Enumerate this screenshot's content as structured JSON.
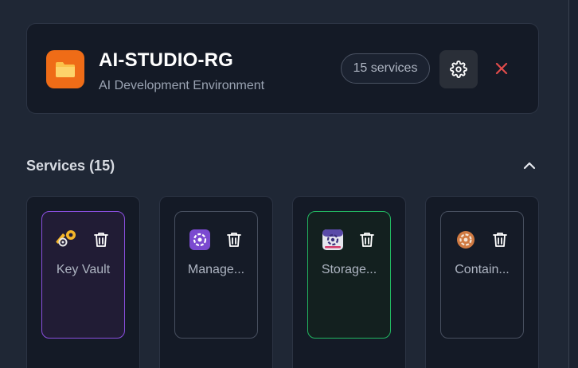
{
  "resource_group": {
    "name": "AI-STUDIO-RG",
    "description": "AI Development Environment",
    "service_count_badge": "15 services",
    "icon": "folder-icon",
    "icon_color": "#ef6c17"
  },
  "actions": {
    "settings_icon": "gear-icon",
    "close_icon": "close-icon",
    "close_color": "#e24c4b"
  },
  "services_section": {
    "heading": "Services (15)",
    "collapse_icon": "chevron-up-icon",
    "items": [
      {
        "label": "Key Vault",
        "icon": "key-vault-icon",
        "state": "selected-purple",
        "accent": "#8b4fe0"
      },
      {
        "label": "Manage...",
        "icon": "managed-identity-icon",
        "state": "default",
        "accent": "#485060"
      },
      {
        "label": "Storage...",
        "icon": "storage-account-icon",
        "state": "selected-green",
        "accent": "#22b862"
      },
      {
        "label": "Contain...",
        "icon": "container-icon",
        "state": "default",
        "accent": "#485060"
      }
    ],
    "delete_icon": "trash-icon"
  }
}
